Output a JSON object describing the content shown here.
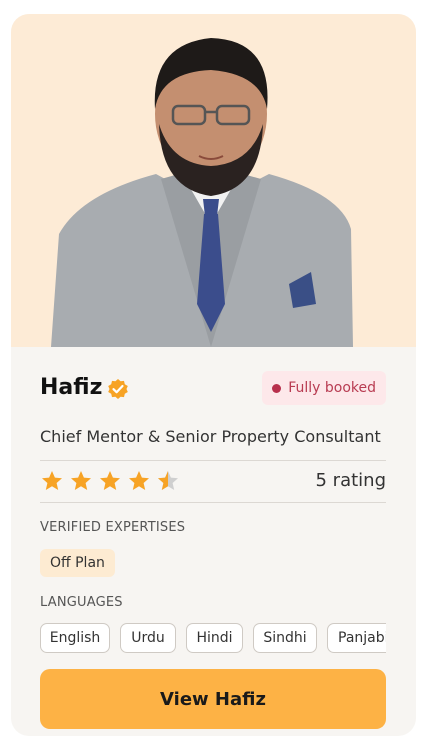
{
  "profile": {
    "name": "Hafiz",
    "title": "Chief Mentor & Senior Property Consultant",
    "status_badge": "Fully booked",
    "rating_text": "5 rating",
    "stars_filled": 4.5,
    "stars_total": 5,
    "photo_icon": "mentor-portrait"
  },
  "expertise": {
    "label": "VERIFIED EXPERTISES",
    "items": [
      "Off Plan"
    ]
  },
  "languages": {
    "label": "LANGUAGES",
    "items": [
      "English",
      "Urdu",
      "Hindi",
      "Sindhi",
      "Panjabi"
    ]
  },
  "cta": {
    "label": "View Hafiz"
  },
  "colors": {
    "accent": "#fdb245",
    "verified": "#f7a325",
    "star": "#f7a325",
    "star_empty": "#cfcfcf",
    "badge_text": "#b83c52",
    "photo_bg": "#fdebd6"
  }
}
